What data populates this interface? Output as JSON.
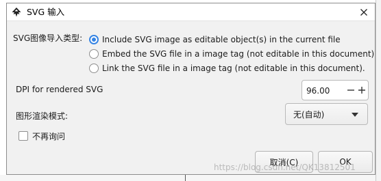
{
  "dialog": {
    "title": "SVG 输入",
    "import_type_label": "SVG图像导入类型:",
    "import_options": [
      {
        "label": "Include SVG image as editable object(s) in the current file",
        "selected": true
      },
      {
        "label": "Embed the SVG file in a image tag (not editable in this document)",
        "selected": false
      },
      {
        "label": "Link the SVG file in a image tag (not editable in this document).",
        "selected": false
      }
    ],
    "dpi_label": "DPI for rendered SVG",
    "dpi_value": "96.00",
    "render_mode_label": "图形渲染模式:",
    "render_mode_value": "无(自动)",
    "dont_ask_label": "不再询问",
    "dont_ask_checked": false,
    "cancel_label": "取消(C)",
    "ok_label": "OK"
  },
  "watermark": "https://blog.csdn.net/QK13812501",
  "colors": {
    "accent": "#3584e4"
  }
}
